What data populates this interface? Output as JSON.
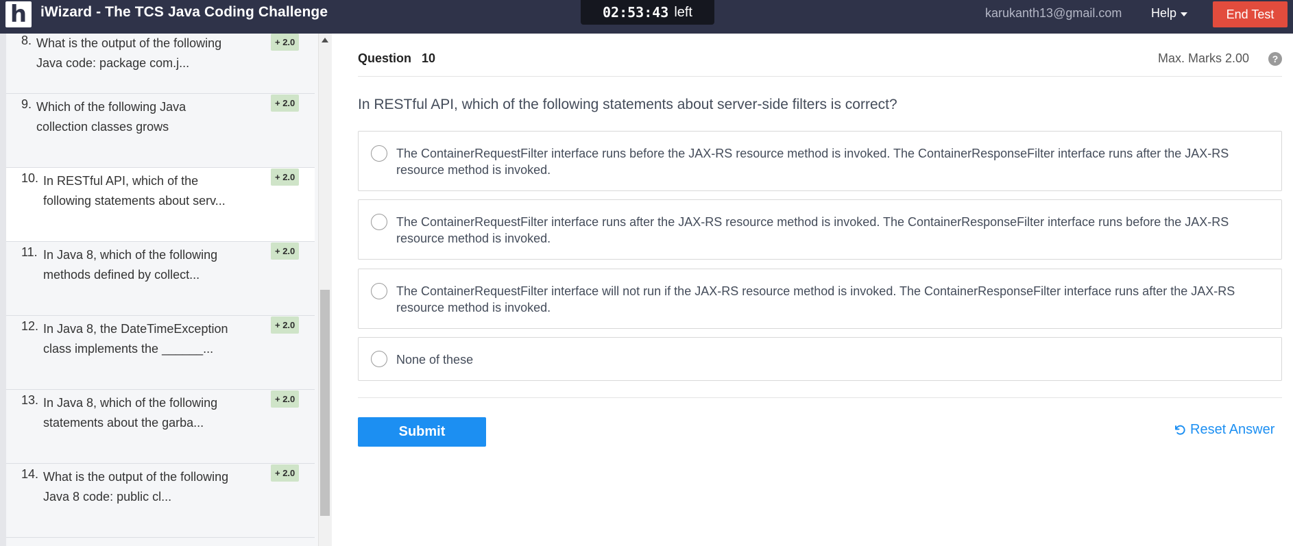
{
  "header": {
    "logo_letter": "h",
    "title": "iWizard - The TCS Java Coding Challenge",
    "timer_value": "02:53:43",
    "timer_suffix": "left",
    "user_email": "karukanth13@gmail.com",
    "help_label": "Help",
    "end_test_label": "End Test"
  },
  "sidebar": {
    "items": [
      {
        "number": "8.",
        "text": "What is the output of the following Java code: package com.j...",
        "marks": "+ 2.0",
        "active": false
      },
      {
        "number": "9.",
        "text": "Which of the following Java collection classes grows",
        "marks": "+ 2.0",
        "active": false
      },
      {
        "number": "10.",
        "text": "In RESTful API, which of the following statements about serv...",
        "marks": "+ 2.0",
        "active": true
      },
      {
        "number": "11.",
        "text": "In Java 8, which of the following methods defined by collect...",
        "marks": "+ 2.0",
        "active": false
      },
      {
        "number": "12.",
        "text": "In Java 8, the DateTimeException class implements the ______...",
        "marks": "+ 2.0",
        "active": false
      },
      {
        "number": "13.",
        "text": "In Java 8, which of the following statements about the garba...",
        "marks": "+ 2.0",
        "active": false
      },
      {
        "number": "14.",
        "text": "What is the output of the following Java 8 code: public cl...",
        "marks": "+ 2.0",
        "active": false
      }
    ]
  },
  "question": {
    "label": "Question",
    "number": "10",
    "max_marks": "Max. Marks 2.00",
    "help_symbol": "?",
    "text": "In RESTful API, which of the following statements about server-side filters is correct?",
    "options": [
      "The ContainerRequestFilter interface runs before the JAX-RS resource method is invoked. The ContainerResponseFilter interface runs after the JAX-RS resource method is invoked.",
      "The ContainerRequestFilter interface runs after the JAX-RS resource method is invoked. The ContainerResponseFilter interface runs before the JAX-RS resource method is invoked.",
      "The ContainerRequestFilter interface will not run if the JAX-RS resource method is invoked. The ContainerResponseFilter interface runs after the JAX-RS resource method is invoked.",
      "None of these"
    ]
  },
  "actions": {
    "submit_label": "Submit",
    "reset_label": "Reset Answer"
  },
  "colors": {
    "topbar": "#2f3349",
    "end_test": "#e24c3d",
    "primary": "#1c8ff2",
    "badge": "#cfe4c8"
  },
  "icons": {
    "reset": "undo-icon",
    "help": "question-circle-icon",
    "dropdown": "caret-down-icon"
  }
}
